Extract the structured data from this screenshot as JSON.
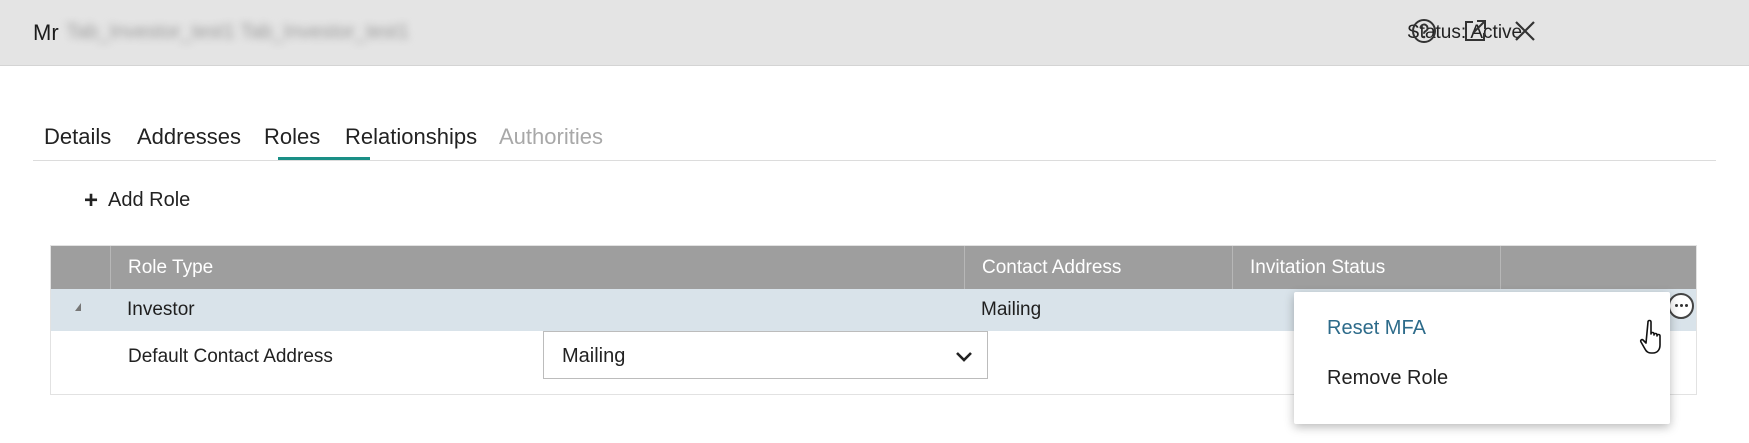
{
  "header": {
    "title_prefix": "Mr",
    "title_name": "Tab_Investor_test1 Tab_Investor_test1",
    "status": "Status: Active",
    "icons": [
      "help-circle-icon",
      "popout-icon",
      "close-icon"
    ]
  },
  "tabs": [
    {
      "label": "Details",
      "state": "normal"
    },
    {
      "label": "Addresses",
      "state": "normal"
    },
    {
      "label": "Roles",
      "state": "active"
    },
    {
      "label": "Relationships",
      "state": "normal"
    },
    {
      "label": "Authorities",
      "state": "disabled"
    }
  ],
  "toolbar": {
    "add_role_label": "Add Role"
  },
  "grid": {
    "columns": [
      "Role Type",
      "Contact Address",
      "Invitation Status"
    ],
    "rows": [
      {
        "role_type": "Investor",
        "contact_address": "Mailing",
        "invitation_status": "",
        "detail": {
          "label": "Default Contact Address",
          "select_value": "Mailing"
        }
      }
    ]
  },
  "context_menu": {
    "items": [
      "Reset MFA",
      "Remove Role"
    ]
  },
  "colors": {
    "accent": "#1a8f86",
    "header_bg": "#9e9e9e",
    "selected_row_bg": "#d9e3ea",
    "menu_highlight": "#2d6b8a",
    "disabled_text": "#a8a8a8"
  }
}
